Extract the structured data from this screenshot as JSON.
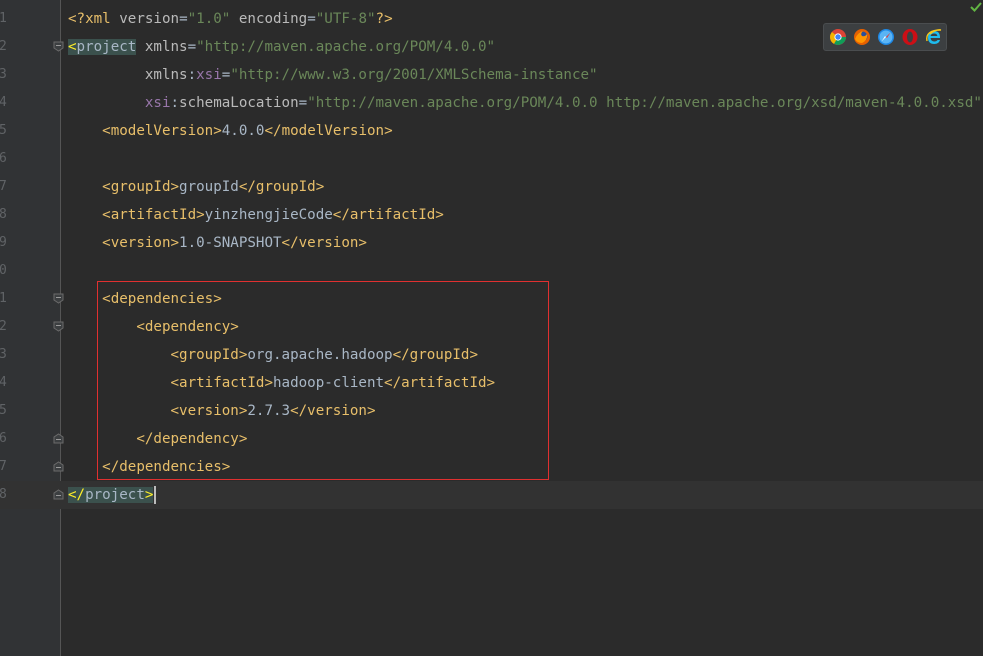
{
  "editor": {
    "file_type": "xml",
    "lines": [
      {
        "num": "1",
        "parts": [
          [
            "pi",
            "<?"
          ],
          [
            "tag",
            "xml"
          ],
          [
            "attr",
            " version"
          ],
          [
            "text",
            "="
          ],
          [
            "str",
            "\"1.0\""
          ],
          [
            "attr",
            " encoding"
          ],
          [
            "text",
            "="
          ],
          [
            "str",
            "\"UTF-8\""
          ],
          [
            "pi",
            "?>"
          ]
        ]
      },
      {
        "num": "2",
        "parts": [
          [
            "hl-bracket",
            "<"
          ],
          [
            "hl-tag",
            "project"
          ],
          [
            "attr",
            " xmlns"
          ],
          [
            "text",
            "="
          ],
          [
            "str",
            "\"http://maven.apache.org/POM/4.0.0\""
          ]
        ]
      },
      {
        "num": "3",
        "parts": [
          [
            "attr",
            "         xmlns"
          ],
          [
            "text",
            ":"
          ],
          [
            "ns",
            "xsi"
          ],
          [
            "text",
            "="
          ],
          [
            "str",
            "\"http://www.w3.org/2001/XMLSchema-instance\""
          ]
        ]
      },
      {
        "num": "4",
        "parts": [
          [
            "ns",
            "         xsi"
          ],
          [
            "text",
            ":"
          ],
          [
            "attr",
            "schemaLocation"
          ],
          [
            "text",
            "="
          ],
          [
            "str",
            "\"http://maven.apache.org/POM/4.0.0 http://maven.apache.org/xsd/maven-4.0.0.xsd\""
          ]
        ]
      },
      {
        "num": "5",
        "parts": [
          [
            "text",
            "    "
          ],
          [
            "tag",
            "<modelVersion>"
          ],
          [
            "text",
            "4.0.0"
          ],
          [
            "tag",
            "</modelVersion>"
          ]
        ]
      },
      {
        "num": "6",
        "parts": []
      },
      {
        "num": "7",
        "parts": [
          [
            "text",
            "    "
          ],
          [
            "tag",
            "<groupId>"
          ],
          [
            "text",
            "groupId"
          ],
          [
            "tag",
            "</groupId>"
          ]
        ]
      },
      {
        "num": "8",
        "parts": [
          [
            "text",
            "    "
          ],
          [
            "tag",
            "<artifactId>"
          ],
          [
            "text",
            "yinzhengjieCode"
          ],
          [
            "tag",
            "</artifactId>"
          ]
        ]
      },
      {
        "num": "9",
        "parts": [
          [
            "text",
            "    "
          ],
          [
            "tag",
            "<version>"
          ],
          [
            "text",
            "1.0-SNAPSHOT"
          ],
          [
            "tag",
            "</version>"
          ]
        ]
      },
      {
        "num": "0",
        "parts": []
      },
      {
        "num": "1",
        "parts": [
          [
            "text",
            "    "
          ],
          [
            "tag",
            "<dependencies>"
          ]
        ]
      },
      {
        "num": "2",
        "parts": [
          [
            "text",
            "        "
          ],
          [
            "tag",
            "<dependency>"
          ]
        ]
      },
      {
        "num": "3",
        "parts": [
          [
            "text",
            "            "
          ],
          [
            "tag",
            "<groupId>"
          ],
          [
            "text",
            "org.apache.hadoop"
          ],
          [
            "tag",
            "</groupId>"
          ]
        ]
      },
      {
        "num": "4",
        "parts": [
          [
            "text",
            "            "
          ],
          [
            "tag",
            "<artifactId>"
          ],
          [
            "text",
            "hadoop-client"
          ],
          [
            "tag",
            "</artifactId>"
          ]
        ]
      },
      {
        "num": "5",
        "parts": [
          [
            "text",
            "            "
          ],
          [
            "tag",
            "<version>"
          ],
          [
            "text",
            "2.7.3"
          ],
          [
            "tag",
            "</version>"
          ]
        ]
      },
      {
        "num": "6",
        "parts": [
          [
            "text",
            "        "
          ],
          [
            "tag",
            "</dependency>"
          ]
        ]
      },
      {
        "num": "7",
        "parts": [
          [
            "text",
            "    "
          ],
          [
            "tag",
            "</dependencies>"
          ]
        ]
      },
      {
        "num": "8",
        "parts": [
          [
            "hl-bracket",
            "</"
          ],
          [
            "hl-tag",
            "project"
          ],
          [
            "hl-bracket",
            ">"
          ]
        ]
      }
    ],
    "fold_lines": [
      1,
      10,
      11,
      15,
      16,
      17
    ],
    "current_line": 17
  },
  "browser_icons": [
    {
      "name": "chrome-icon",
      "color": "#dd4b39"
    },
    {
      "name": "firefox-icon",
      "color": "#e66000"
    },
    {
      "name": "safari-icon",
      "color": "#1e88e5"
    },
    {
      "name": "opera-icon",
      "color": "#cc0f16"
    },
    {
      "name": "ie-icon",
      "color": "#1ebbee"
    }
  ],
  "status": {
    "check_icon": "checkmark-icon",
    "check_color": "#62b543"
  }
}
